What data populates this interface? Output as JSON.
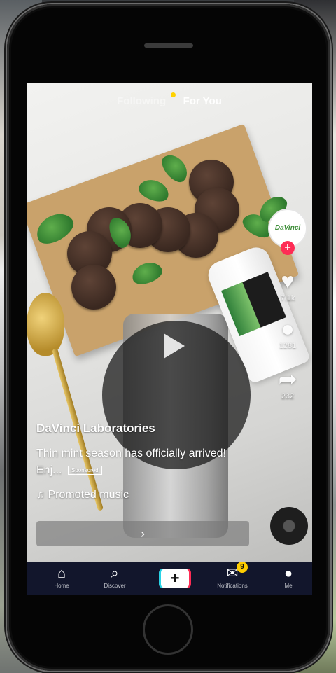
{
  "top_tabs": {
    "following": "Following",
    "for_you": "For You"
  },
  "post": {
    "username": "DaVinci Laboratories",
    "description": "Thin mint season has officially arrived! Enj...",
    "sponsored_tag": "Sponsored",
    "music": "♫ Promoted music",
    "cta_symbol": "›"
  },
  "creator_avatar_text": "DaVinci",
  "rail": {
    "likes": "7.1k",
    "comments": "1281",
    "shares": "232"
  },
  "nav": {
    "home": "Home",
    "discover": "Discover",
    "create": "+",
    "inbox": "Notifications",
    "inbox_badge": "9",
    "me": "Me"
  },
  "colors": {
    "accent_red": "#fe2c55",
    "accent_cyan": "#29d3e6",
    "nav_bg": "#12162c"
  }
}
